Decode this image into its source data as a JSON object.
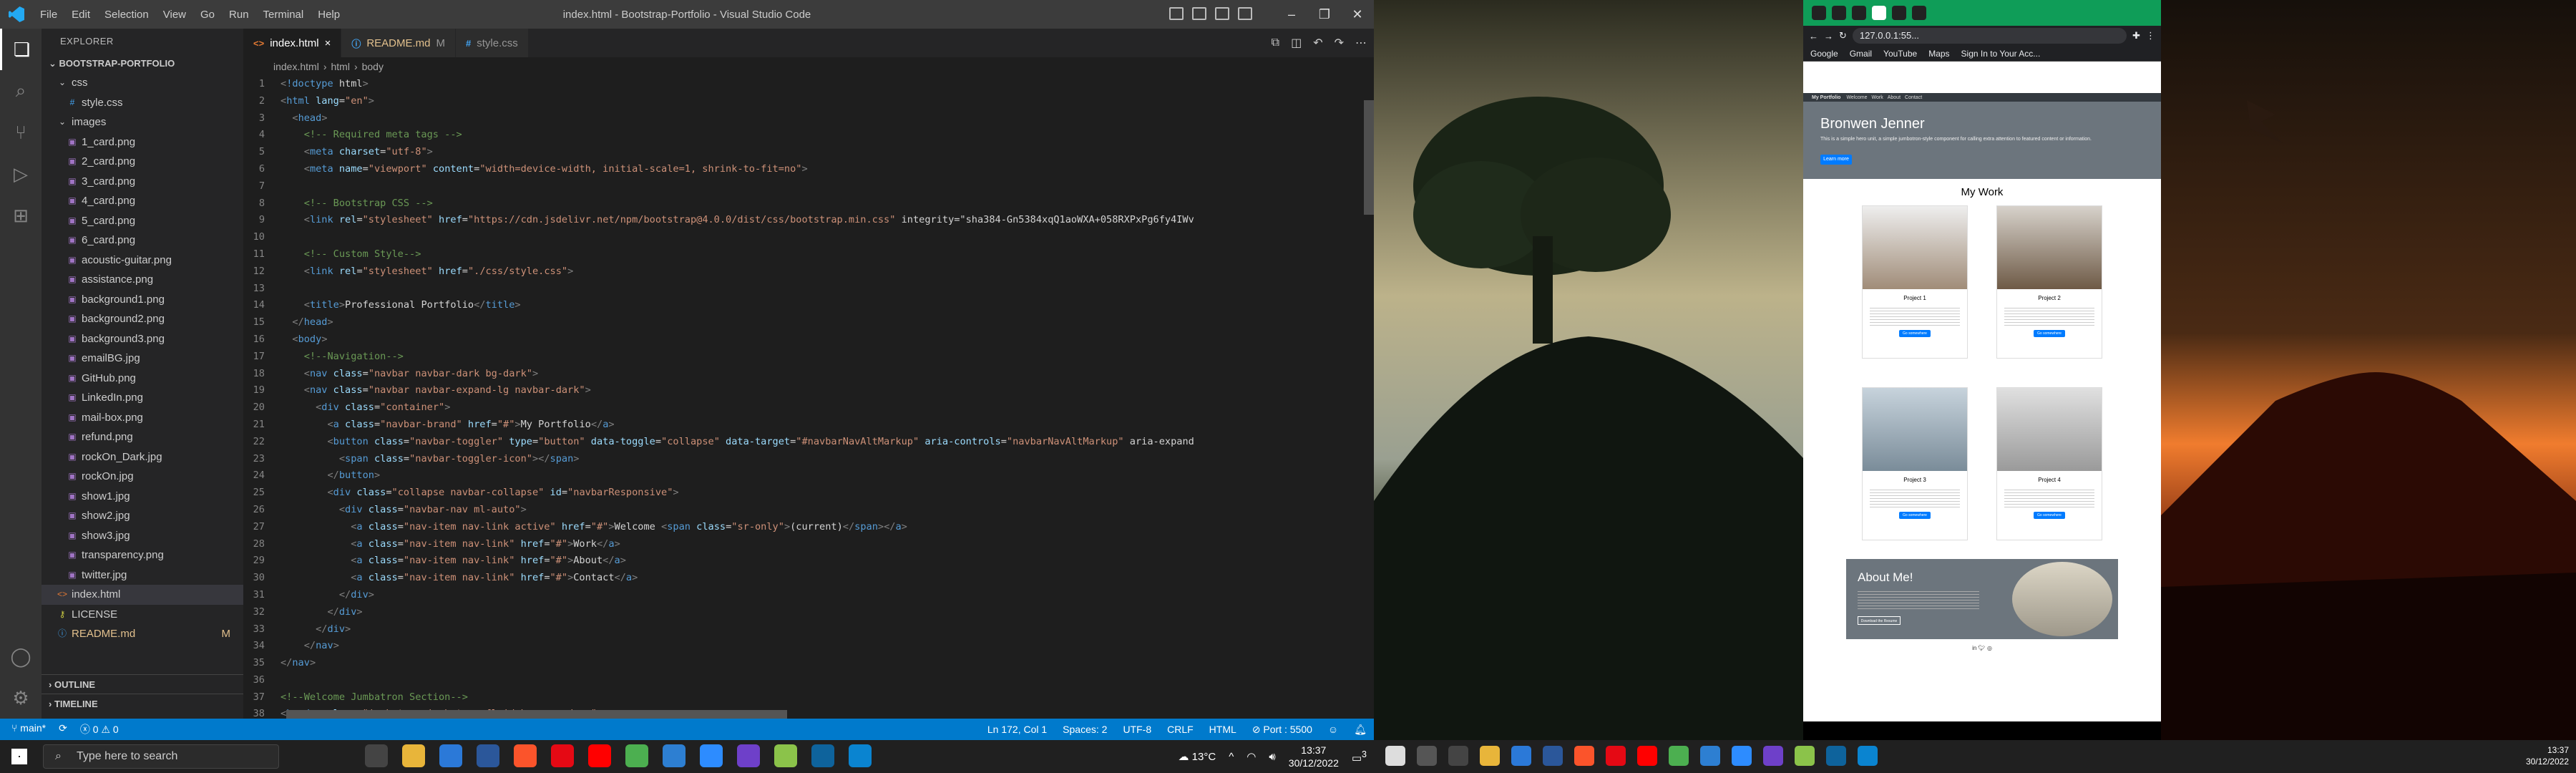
{
  "vscode": {
    "menu": [
      "File",
      "Edit",
      "Selection",
      "View",
      "Go",
      "Run",
      "Terminal",
      "Help"
    ],
    "title": "index.html - Bootstrap-Portfolio - Visual Studio Code",
    "explorer": {
      "header": "EXPLORER",
      "project": "BOOTSTRAP-PORTFOLIO",
      "items": [
        {
          "label": "css",
          "type": "folder",
          "depth": 1
        },
        {
          "label": "style.css",
          "type": "css",
          "depth": 2
        },
        {
          "label": "images",
          "type": "folder",
          "depth": 1
        },
        {
          "label": "1_card.png",
          "type": "image",
          "depth": 2
        },
        {
          "label": "2_card.png",
          "type": "image",
          "depth": 2
        },
        {
          "label": "3_card.png",
          "type": "image",
          "depth": 2
        },
        {
          "label": "4_card.png",
          "type": "image",
          "depth": 2
        },
        {
          "label": "5_card.png",
          "type": "image",
          "depth": 2
        },
        {
          "label": "6_card.png",
          "type": "image",
          "depth": 2
        },
        {
          "label": "acoustic-guitar.png",
          "type": "image",
          "depth": 2
        },
        {
          "label": "assistance.png",
          "type": "image",
          "depth": 2
        },
        {
          "label": "background1.png",
          "type": "image",
          "depth": 2
        },
        {
          "label": "background2.png",
          "type": "image",
          "depth": 2
        },
        {
          "label": "background3.png",
          "type": "image",
          "depth": 2
        },
        {
          "label": "emailBG.jpg",
          "type": "image",
          "depth": 2
        },
        {
          "label": "GitHub.png",
          "type": "image",
          "depth": 2
        },
        {
          "label": "LinkedIn.png",
          "type": "image",
          "depth": 2
        },
        {
          "label": "mail-box.png",
          "type": "image",
          "depth": 2
        },
        {
          "label": "refund.png",
          "type": "image",
          "depth": 2
        },
        {
          "label": "rockOn_Dark.jpg",
          "type": "image",
          "depth": 2
        },
        {
          "label": "rockOn.jpg",
          "type": "image",
          "depth": 2
        },
        {
          "label": "show1.jpg",
          "type": "image",
          "depth": 2
        },
        {
          "label": "show2.jpg",
          "type": "image",
          "depth": 2
        },
        {
          "label": "show3.jpg",
          "type": "image",
          "depth": 2
        },
        {
          "label": "transparency.png",
          "type": "image",
          "depth": 2
        },
        {
          "label": "twitter.jpg",
          "type": "image",
          "depth": 2
        },
        {
          "label": "index.html",
          "type": "html",
          "depth": 1,
          "active": true
        },
        {
          "label": "LICENSE",
          "type": "license",
          "depth": 1
        },
        {
          "label": "README.md",
          "type": "md",
          "depth": 1,
          "badge": "M"
        }
      ],
      "outline": "OUTLINE",
      "timeline": "TIMELINE"
    },
    "tabs": [
      {
        "label": "index.html",
        "icon": "html-icon",
        "active": true,
        "close": "×"
      },
      {
        "label": "README.md",
        "icon": "info-icon",
        "badge": "M"
      },
      {
        "label": "style.css",
        "icon": "css-icon"
      }
    ],
    "breadcrumb": [
      "index.html",
      "html",
      "body"
    ],
    "code": [
      "<!doctype html>",
      "<html lang=\"en\">",
      "  <head>",
      "    <!-- Required meta tags -->",
      "    <meta charset=\"utf-8\">",
      "    <meta name=\"viewport\" content=\"width=device-width, initial-scale=1, shrink-to-fit=no\">",
      "",
      "    <!-- Bootstrap CSS -->",
      "    <link rel=\"stylesheet\" href=\"https://cdn.jsdelivr.net/npm/bootstrap@4.0.0/dist/css/bootstrap.min.css\" integrity=\"sha384-Gn5384xqQ1aoWXA+058RXPxPg6fy4IWv",
      "",
      "    <!-- Custom Style-->",
      "    <link rel=\"stylesheet\" href=\"./css/style.css\">",
      "",
      "    <title>Professional Portfolio</title>",
      "  </head>",
      "  <body>",
      "    <!--Navigation-->",
      "    <nav class=\"navbar navbar-dark bg-dark\">",
      "    <nav class=\"navbar navbar-expand-lg navbar-dark\">",
      "      <div class=\"container\">",
      "        <a class=\"navbar-brand\" href=\"#\">My Portfolio</a>",
      "        <button class=\"navbar-toggler\" type=\"button\" data-toggle=\"collapse\" data-target=\"#navbarNavAltMarkup\" aria-controls=\"navbarNavAltMarkup\" aria-expand",
      "          <span class=\"navbar-toggler-icon\"></span>",
      "        </button>",
      "        <div class=\"collapse navbar-collapse\" id=\"navbarResponsive\">",
      "          <div class=\"navbar-nav ml-auto\">",
      "            <a class=\"nav-item nav-link active\" href=\"#\">Welcome <span class=\"sr-only\">(current)</span></a>",
      "            <a class=\"nav-item nav-link\" href=\"#\">Work</a>",
      "            <a class=\"nav-item nav-link\" href=\"#\">About</a>",
      "            <a class=\"nav-item nav-link\" href=\"#\">Contact</a>",
      "          </div>",
      "        </div>",
      "      </div>",
      "    </nav>",
      "</nav>",
      "",
      "<!--Welcome Jumbatron Section-->",
      "<header class=\"jumbotron jumbotron-fluid bg-secondary\">"
    ],
    "status": {
      "branch": "main*",
      "sync": "⟳",
      "errors": "0",
      "warnings": "0",
      "position": "Ln 172, Col 1",
      "spaces": "Spaces: 2",
      "encoding": "UTF-8",
      "eol": "CRLF",
      "language": "HTML",
      "port": "Port : 5500"
    }
  },
  "browser": {
    "url": "127.0.0.1:55...",
    "bookmarks": [
      "Google",
      "Gmail",
      "YouTube",
      "Maps",
      "Sign In to Your Acc..."
    ],
    "site": {
      "nav_brand": "My Portfolio",
      "nav_links": [
        "Welcome",
        "Work",
        "About",
        "Contact"
      ],
      "jumbo_title": "Bronwen Jenner",
      "jumbo_text": "This is a simple hero unit, a simple jumbotron-style component for calling extra attention to featured content or information.",
      "jumbo_btn": "Learn more",
      "work_title": "My Work",
      "cards": [
        {
          "title": "Project 1",
          "btn": "Go somewhere"
        },
        {
          "title": "Project 2",
          "btn": "Go somewhere"
        },
        {
          "title": "Project 3",
          "btn": "Go somewhere"
        },
        {
          "title": "Project 4",
          "btn": "Go somewhere"
        }
      ],
      "about_title": "About Me!",
      "about_btn": "Download the Resume"
    }
  },
  "taskbar": {
    "search_placeholder": "Type here to search",
    "weather": "13°C",
    "time": "13:37",
    "date": "30/12/2022",
    "notif": "3",
    "time2": "13:37",
    "date2": "30/12/2022"
  }
}
